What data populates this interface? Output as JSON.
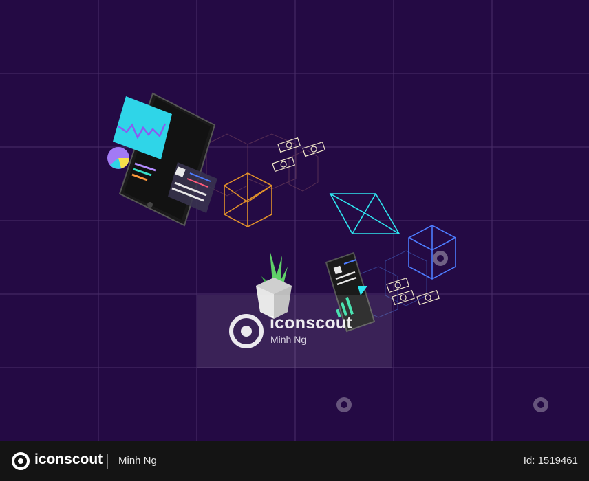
{
  "watermark": {
    "brand": "iconscout",
    "author": "Minh Ng"
  },
  "footer": {
    "brand": "iconscout",
    "author": "Minh Ng",
    "id_text": "Id: 1519461"
  },
  "colors": {
    "background": "#240a44",
    "grid": "#4a2e6a",
    "cyan": "#2ee6f0",
    "orange": "#e0902a",
    "blue": "#4d7cff",
    "green": "#5fd068",
    "footer": "#141414"
  },
  "icons": [
    "tablet-icon",
    "pie-chart-icon",
    "isometric-cube-icon",
    "money-note-icon",
    "crystal-icon",
    "plant-pot-icon",
    "smartphone-icon",
    "iconscout-logo-icon"
  ]
}
